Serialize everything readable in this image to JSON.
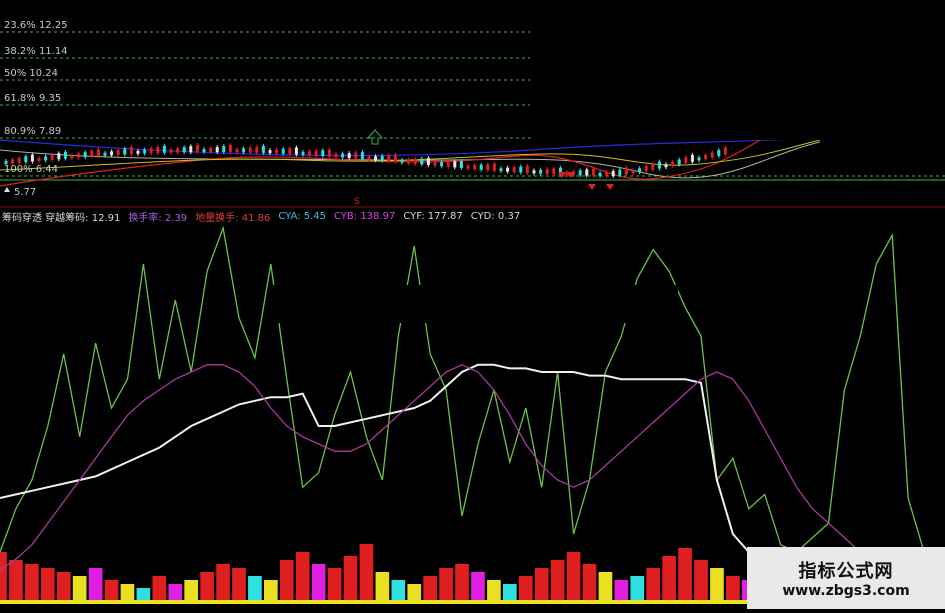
{
  "colors": {
    "background": "#000000",
    "fib_line": "#3bb54a",
    "green_line": "#6cc24a",
    "white_line": "#f0f0f0",
    "purple_line": "#a63aa0",
    "blue_line": "#2a2ae0",
    "red": "#e02020",
    "cyan": "#2ee0e0",
    "magenta": "#e020e0",
    "yellow": "#e8e020"
  },
  "price_panel": {
    "fib_levels": [
      {
        "label": "23.6% 12.25"
      },
      {
        "label": "38.2% 11.14"
      },
      {
        "label": "50% 10.24"
      },
      {
        "label": "61.8% 9.35"
      },
      {
        "label": "80.9% 7.89"
      },
      {
        "label": "100% 6.44"
      }
    ],
    "low_label": "5.77",
    "signal_label": "S"
  },
  "indicator_bar": {
    "items": [
      {
        "text": "筹码穿透  穿越筹码: 12.91",
        "color": "#d8d8d8"
      },
      {
        "text": "换手率: 2.39",
        "color": "#a060e0"
      },
      {
        "text": "地量换手: 41.86",
        "color": "#e04040"
      },
      {
        "text": "CYA: 5.45",
        "color": "#40c0e0"
      },
      {
        "text": "CYB: 138.97",
        "color": "#e040e0"
      },
      {
        "text": "CYF: 177.87",
        "color": "#d8d8d8"
      },
      {
        "text": "CYD: 0.37",
        "color": "#d8d8d8"
      }
    ]
  },
  "watermark": {
    "title": "指标公式网",
    "url": "www.zbgs3.com"
  },
  "chart_data": {
    "type": "line",
    "title": "",
    "xlabel": "",
    "ylabel": "",
    "x_count": 60,
    "series": [
      {
        "color_key": "green_line",
        "values": [
          10,
          22,
          30,
          45,
          65,
          42,
          68,
          50,
          58,
          90,
          58,
          80,
          60,
          88,
          100,
          75,
          64,
          90,
          58,
          28,
          32,
          48,
          60,
          42,
          30,
          70,
          95,
          65,
          55,
          20,
          40,
          55,
          35,
          50,
          28,
          60,
          15,
          30,
          60,
          70,
          86,
          94,
          88,
          78,
          70,
          30,
          36,
          22,
          26,
          12,
          10,
          14,
          18,
          55,
          70,
          90,
          98,
          25,
          10,
          8
        ]
      },
      {
        "color_key": "white_line",
        "values": [
          25,
          26,
          27,
          28,
          29,
          30,
          31,
          33,
          35,
          37,
          39,
          42,
          45,
          47,
          49,
          51,
          52,
          53,
          53,
          54,
          45,
          45,
          46,
          47,
          48,
          49,
          50,
          52,
          56,
          60,
          62,
          62,
          61,
          61,
          60,
          60,
          60,
          59,
          59,
          58,
          58,
          58,
          58,
          58,
          57,
          30,
          15,
          10,
          8,
          6,
          5,
          4,
          4,
          3,
          3,
          3,
          3,
          3,
          3,
          3
        ]
      },
      {
        "color_key": "purple_line",
        "values": [
          5,
          8,
          12,
          18,
          24,
          30,
          36,
          42,
          48,
          52,
          55,
          58,
          60,
          62,
          62,
          60,
          56,
          50,
          45,
          42,
          40,
          38,
          38,
          40,
          44,
          48,
          52,
          56,
          60,
          62,
          60,
          55,
          48,
          40,
          34,
          30,
          28,
          30,
          34,
          38,
          42,
          46,
          50,
          54,
          58,
          60,
          58,
          52,
          44,
          36,
          28,
          22,
          18,
          14,
          10,
          8,
          6,
          5,
          4,
          3
        ]
      }
    ],
    "volume_bars": {
      "values": [
        12,
        10,
        9,
        8,
        7,
        6,
        8,
        5,
        4,
        3,
        6,
        4,
        5,
        7,
        9,
        8,
        6,
        5,
        10,
        12,
        9,
        8,
        11,
        14,
        7,
        5,
        4,
        6,
        8,
        9,
        7,
        5,
        4,
        6,
        8,
        10,
        12,
        9,
        7,
        5,
        6,
        8,
        11,
        13,
        10,
        8,
        6,
        5,
        4,
        3,
        4,
        5,
        6,
        5,
        4,
        3,
        3,
        2,
        2,
        2
      ],
      "color_keys": [
        "red",
        "red",
        "red",
        "red",
        "red",
        "yellow",
        "magenta",
        "red",
        "yellow",
        "cyan",
        "red",
        "magenta",
        "yellow",
        "red",
        "red",
        "red",
        "cyan",
        "yellow",
        "red",
        "red",
        "magenta",
        "red",
        "red",
        "red",
        "yellow",
        "cyan",
        "yellow",
        "red",
        "red",
        "red",
        "magenta",
        "yellow",
        "cyan",
        "red",
        "red",
        "red",
        "red",
        "red",
        "yellow",
        "magenta",
        "cyan",
        "red",
        "red",
        "red",
        "red",
        "yellow",
        "red",
        "magenta",
        "yellow",
        "cyan",
        "red",
        "red",
        "red",
        "yellow",
        "red",
        "yellow",
        "red",
        "yellow",
        "red",
        "yellow"
      ]
    }
  }
}
